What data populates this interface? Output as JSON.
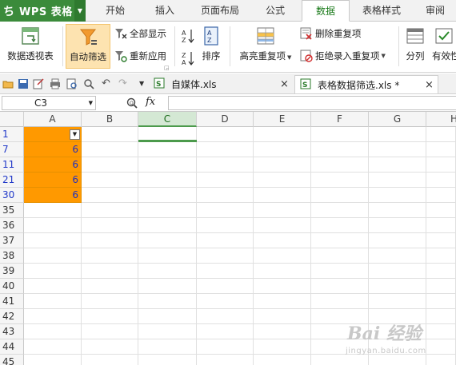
{
  "app": {
    "logo": "ち",
    "name": "WPS 表格"
  },
  "menu_tabs": [
    "开始",
    "插入",
    "页面布局",
    "公式",
    "数据",
    "表格样式",
    "审阅"
  ],
  "ribbon": {
    "pivot_table": "数据透视表",
    "auto_filter": "自动筛选",
    "show_all": "全部显示",
    "reapply": "重新应用",
    "sort": "排序",
    "highlight_duplicates": "高亮重复项",
    "delete_duplicates": "删除重复项",
    "reject_duplicates": "拒绝录入重复项",
    "split_column": "分列",
    "validity": "有效性"
  },
  "doc_tabs": [
    {
      "name": "自媒体.xls"
    },
    {
      "name": "表格数据筛选.xls *"
    }
  ],
  "formula_bar": {
    "cell_ref": "C3",
    "fx": "fx",
    "value": ""
  },
  "columns": [
    "A",
    "B",
    "C",
    "D",
    "E",
    "F",
    "G",
    "H"
  ],
  "rows": [
    {
      "num": "1",
      "a": ""
    },
    {
      "num": "7",
      "a": "6"
    },
    {
      "num": "11",
      "a": "6"
    },
    {
      "num": "21",
      "a": "6"
    },
    {
      "num": "30",
      "a": "6"
    },
    {
      "num": "35",
      "a": ""
    },
    {
      "num": "36",
      "a": ""
    },
    {
      "num": "37",
      "a": ""
    },
    {
      "num": "38",
      "a": ""
    },
    {
      "num": "39",
      "a": ""
    },
    {
      "num": "40",
      "a": ""
    },
    {
      "num": "41",
      "a": ""
    },
    {
      "num": "42",
      "a": ""
    },
    {
      "num": "43",
      "a": ""
    },
    {
      "num": "44",
      "a": ""
    },
    {
      "num": "45",
      "a": ""
    }
  ],
  "watermark": {
    "main": "Bai 经验",
    "sub": "jingyan.baidu.com"
  },
  "colors": {
    "accent_green": "#3b8b3b",
    "filtered_cell": "#ff9900",
    "filtered_row_num": "#2038c8"
  }
}
